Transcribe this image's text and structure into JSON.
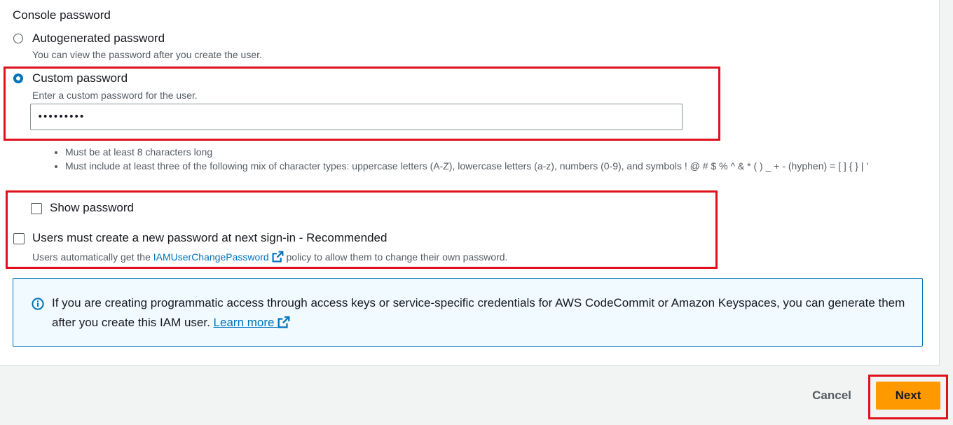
{
  "section": {
    "title": "Console password"
  },
  "options": {
    "autogenerated": {
      "label": "Autogenerated password",
      "description": "You can view the password after you create the user.",
      "selected": false
    },
    "custom": {
      "label": "Custom password",
      "description": "Enter a custom password for the user.",
      "selected": true,
      "value": "•••••••••"
    }
  },
  "requirements": [
    "Must be at least 8 characters long",
    "Must include at least three of the following mix of character types: uppercase letters (A-Z), lowercase letters (a-z), numbers (0-9), and symbols ! @ # $ % ^ & * ( ) _ + - (hyphen) = [ ] { } | '"
  ],
  "show_password": {
    "label": "Show password",
    "checked": false
  },
  "reset_required": {
    "label": "Users must create a new password at next sign-in - Recommended",
    "checked": false,
    "desc_before": "Users automatically get the ",
    "link": "IAMUserChangePassword",
    "desc_after": " policy to allow them to change their own password."
  },
  "info": {
    "text": "If you are creating programmatic access through access keys or service-specific credentials for AWS CodeCommit or Amazon Keyspaces, you can generate them after you create this IAM user. ",
    "link": "Learn more"
  },
  "footer": {
    "cancel": "Cancel",
    "next": "Next"
  },
  "colors": {
    "accent": "#0073bb",
    "primary_button": "#ff9900",
    "highlight_box": "#e0101d",
    "info_bg": "#f1faff"
  },
  "icons": [
    "external-link-icon",
    "info-icon"
  ]
}
